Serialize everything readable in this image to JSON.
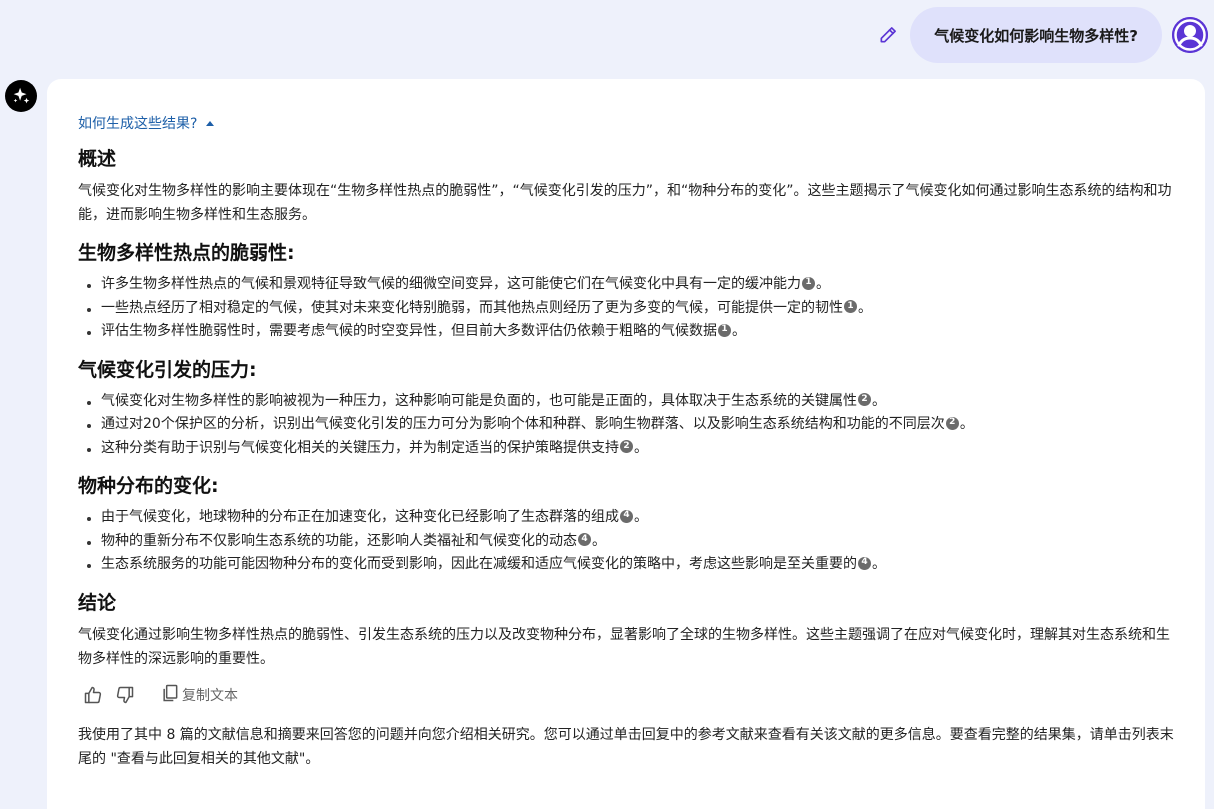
{
  "query": {
    "text": "气候变化如何影响生物多样性?"
  },
  "answer": {
    "how_link": "如何生成这些结果?",
    "overview_title": "概述",
    "overview_text": "气候变化对生物多样性的影响主要体现在“生物多样性热点的脆弱性”，“气候变化引发的压力”，和“物种分布的变化”。这些主题揭示了气候变化如何通过影响生态系统的结构和功能，进而影响生物多样性和生态服务。",
    "sections": [
      {
        "title": "生物多样性热点的脆弱性:",
        "items": [
          {
            "text": "许多生物多样性热点的气候和景观特征导致气候的细微空间变异，这可能使它们在气候变化中具有一定的缓冲能力",
            "cite": "1",
            "end": "。"
          },
          {
            "text": "一些热点经历了相对稳定的气候，使其对未来变化特别脆弱，而其他热点则经历了更为多变的气候，可能提供一定的韧性",
            "cite": "1",
            "end": "。"
          },
          {
            "text": "评估生物多样性脆弱性时，需要考虑气候的时空变异性，但目前大多数评估仍依赖于粗略的气候数据",
            "cite": "1",
            "end": "。"
          }
        ]
      },
      {
        "title": "气候变化引发的压力:",
        "items": [
          {
            "text": "气候变化对生物多样性的影响被视为一种压力，这种影响可能是负面的，也可能是正面的，具体取决于生态系统的关键属性",
            "cite": "2",
            "end": "。"
          },
          {
            "text": "通过对20个保护区的分析，识别出气候变化引发的压力可分为影响个体和种群、影响生物群落、以及影响生态系统结构和功能的不同层次",
            "cite": "2",
            "end": "。"
          },
          {
            "text": "这种分类有助于识别与气候变化相关的关键压力，并为制定适当的保护策略提供支持",
            "cite": "2",
            "end": "。"
          }
        ]
      },
      {
        "title": "物种分布的变化:",
        "items": [
          {
            "text": "由于气候变化，地球物种的分布正在加速变化，这种变化已经影响了生态群落的组成",
            "cite": "4",
            "end": "。"
          },
          {
            "text": "物种的重新分布不仅影响生态系统的功能，还影响人类福祉和气候变化的动态",
            "cite": "4",
            "end": "。"
          },
          {
            "text": "生态系统服务的功能可能因物种分布的变化而受到影响，因此在减缓和适应气候变化的策略中，考虑这些影响是至关重要的",
            "cite": "4",
            "end": "。"
          }
        ]
      }
    ],
    "conclusion_title": "结论",
    "conclusion_text": "气候变化通过影响生物多样性热点的脆弱性、引发生态系统的压力以及改变物种分布，显著影响了全球的生物多样性。这些主题强调了在应对气候变化时，理解其对生态系统和生物多样性的深远影响的重要性。",
    "copy_label": "复制文本",
    "footer_text": "我使用了其中 8 篇的文献信息和摘要来回答您的问题并向您介绍相关研究。您可以通过单击回复中的参考文献来查看有关该文献的更多信息。要查看完整的结果集，请单击列表末尾的 \"查看与此回复相关的其他文献\"。"
  },
  "icons": {
    "edit": "pencil-icon",
    "avatar": "user-icon",
    "ai": "sparkle-icon",
    "like": "thumbs-up-icon",
    "dislike": "thumbs-down-icon",
    "copy": "copy-icon"
  },
  "colors": {
    "background": "#eef1fb",
    "query_bubble": "#dfe1fb",
    "accent": "#5b35d5",
    "link": "#1d5fa8"
  }
}
